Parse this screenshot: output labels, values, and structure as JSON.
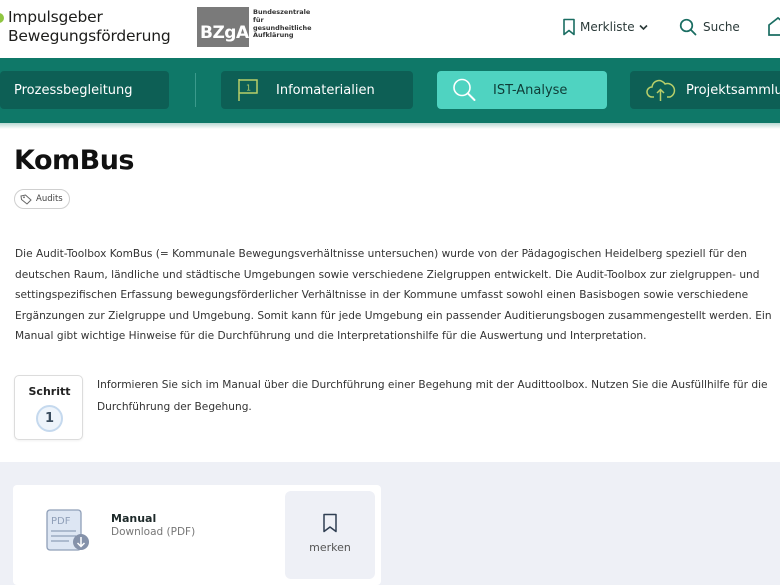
{
  "header": {
    "logo_line1": "Impulsgeber",
    "logo_line2": "Bewegungsförderung",
    "bzga_logo": "BZgA",
    "bzga_line1": "Bundeszentrale",
    "bzga_line2": "für",
    "bzga_line3": "gesundheitliche",
    "bzga_line4": "Aufklärung",
    "merkliste_label": "Merkliste",
    "suche_label": "Suche",
    "icons": {
      "merkliste": "bookmark-icon",
      "dropdown": "chevron-down-icon",
      "suche": "search-icon",
      "home": "home-icon"
    }
  },
  "nav": {
    "tabs": [
      {
        "label": "Prozessbegleitung",
        "icon": "",
        "active": false
      },
      {
        "label": "Infomaterialien",
        "icon": "flag-icon",
        "active": false
      },
      {
        "label": "IST-Analyse",
        "icon": "magnifier-icon",
        "active": true
      },
      {
        "label": "Projektsammlung",
        "icon": "cloud-upload-icon",
        "active": false
      }
    ]
  },
  "page": {
    "title": "KomBus",
    "tag": "Audits",
    "description": "Die Audit-Toolbox KomBus (= Kommunale Bewegungsverhältnisse untersuchen) wurde von der Pädagogischen Heidelberg speziell für den deutschen Raum, ländliche und städtische Umgebungen sowie verschiedene Zielgruppen entwickelt. Die Audit-Toolbox zur zielgruppen- und settingspezifischen Erfassung bewegungsförderlicher Verhältnisse in der Kommune umfasst sowohl einen Basisbogen sowie verschiedene Ergänzungen zur Zielgruppe und Umgebung. Somit kann für jede Umgebung ein passender Auditierungsbogen zusammengestellt werden. Ein Manual gibt wichtige Hinweise für die Durchführung und die Interpretationshilfe für die Auswertung und Interpretation."
  },
  "step": {
    "label": "Schritt",
    "number": "1",
    "text": "Informieren Sie sich im Manual über die Durchführung einer Begehung mit der Audittoolbox. Nutzen Sie die Ausfüllhilfe für die Durchführung der Begehung."
  },
  "download": {
    "title": "Manual",
    "subtitle": "Download (PDF)",
    "icon_text": "PDF",
    "merken_label": "merken"
  },
  "colors": {
    "nav_bg": "#0f7868",
    "tab_bg": "#0d5f55",
    "tab_active": "#4fd3c1",
    "accent": "#1a5d55"
  }
}
